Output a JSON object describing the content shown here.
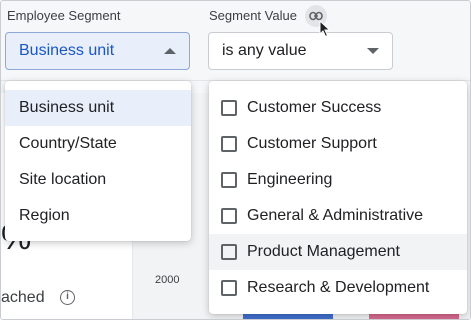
{
  "background": {
    "percent_fragment": "%",
    "reached_label": "ached",
    "chart_tick": "2000"
  },
  "segment": {
    "label": "Employee Segment",
    "selected": "Business unit",
    "options": [
      "Business unit",
      "Country/State",
      "Site location",
      "Region"
    ]
  },
  "value": {
    "label": "Segment Value",
    "selected": "is any value",
    "options": [
      "Customer Success",
      "Customer Support",
      "Engineering",
      "General & Administrative",
      "Product Management",
      "Research & Development"
    ]
  },
  "colors": {
    "accent": "#1a56c4",
    "selected_bg": "#e8eefa",
    "bar_blue": "#3f6fcf",
    "bar_pink": "#d96a8f"
  },
  "icons": {
    "link": "link-icon",
    "info": "info-icon",
    "cursor": "mouse-pointer-icon"
  }
}
